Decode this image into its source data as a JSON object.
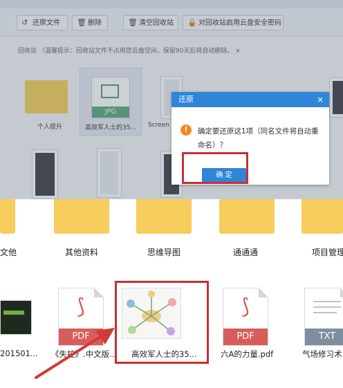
{
  "toolbar": {
    "restore_label": "还原文件",
    "delete_label": "删除",
    "clear_label": "清空回收站",
    "password_label": "对回收站启用云盘安全密码"
  },
  "notice": "回收站 （温馨提示：回收站文件不占用您云盘空间，保留90天后将自动删除。 ×",
  "recycle_items": [
    {
      "label": "个人提升",
      "type": "folder"
    },
    {
      "label": "高效军人士的35...",
      "type": "jpg",
      "badge": "JPG"
    },
    {
      "label": "Screen",
      "type": "screenshot"
    }
  ],
  "dialog": {
    "title": "还原",
    "close": "×",
    "icon": "!",
    "message": "确定要还原这1项（同名文件将自动重命名）？",
    "confirm_label": "确 定"
  },
  "folders": [
    {
      "label": "文他"
    },
    {
      "label": "其他资料"
    },
    {
      "label": "思维导图"
    },
    {
      "label": "通通通"
    },
    {
      "label": "项目管理"
    }
  ],
  "files": [
    {
      "label": "201501..."
    },
    {
      "label": "《失控》.中文版...",
      "badge": "PDF"
    },
    {
      "label": "高效军人士的35..."
    },
    {
      "label": "六A的力量.pdf",
      "badge": "PDF"
    },
    {
      "label": "气场修习术",
      "badge": "TXT"
    }
  ],
  "colors": {
    "accent": "#2f86d8",
    "highlight": "#c92f2f",
    "folder": "#f7cd5d",
    "pdf_band": "#d95c5c",
    "txt_band": "#7d8e9e",
    "warning": "#f08a24"
  }
}
